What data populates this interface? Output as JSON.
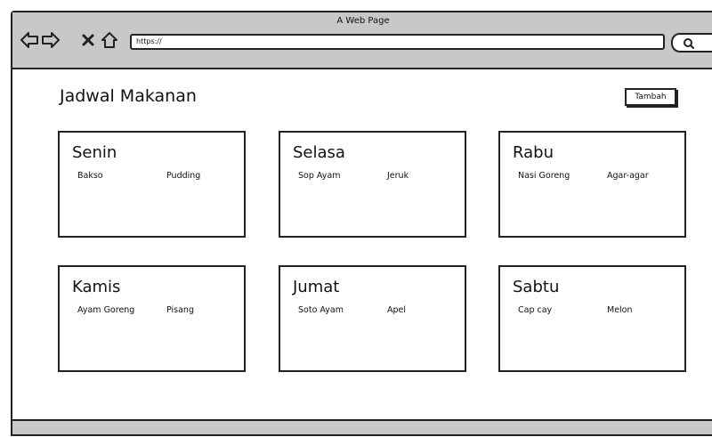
{
  "browser": {
    "window_title": "A Web Page",
    "url": "https://",
    "icons": [
      "back-arrow-icon",
      "forward-arrow-icon",
      "close-icon",
      "home-icon",
      "search-icon"
    ]
  },
  "page": {
    "title": "Jadwal Makanan",
    "add_button_label": "Tambah"
  },
  "schedule": [
    {
      "day": "Senin",
      "items": [
        "Bakso",
        "Pudding"
      ]
    },
    {
      "day": "Selasa",
      "items": [
        "Sop Ayam",
        "Jeruk"
      ]
    },
    {
      "day": "Rabu",
      "items": [
        "Nasi Goreng",
        "Agar-agar"
      ]
    },
    {
      "day": "Kamis",
      "items": [
        "Ayam Goreng",
        "Pisang"
      ]
    },
    {
      "day": "Jumat",
      "items": [
        "Soto Ayam",
        "Apel"
      ]
    },
    {
      "day": "Sabtu",
      "items": [
        "Cap cay",
        "Melon"
      ]
    }
  ],
  "colors": {
    "chrome": "#c8c8c8",
    "border": "#222222",
    "background": "#ffffff"
  }
}
